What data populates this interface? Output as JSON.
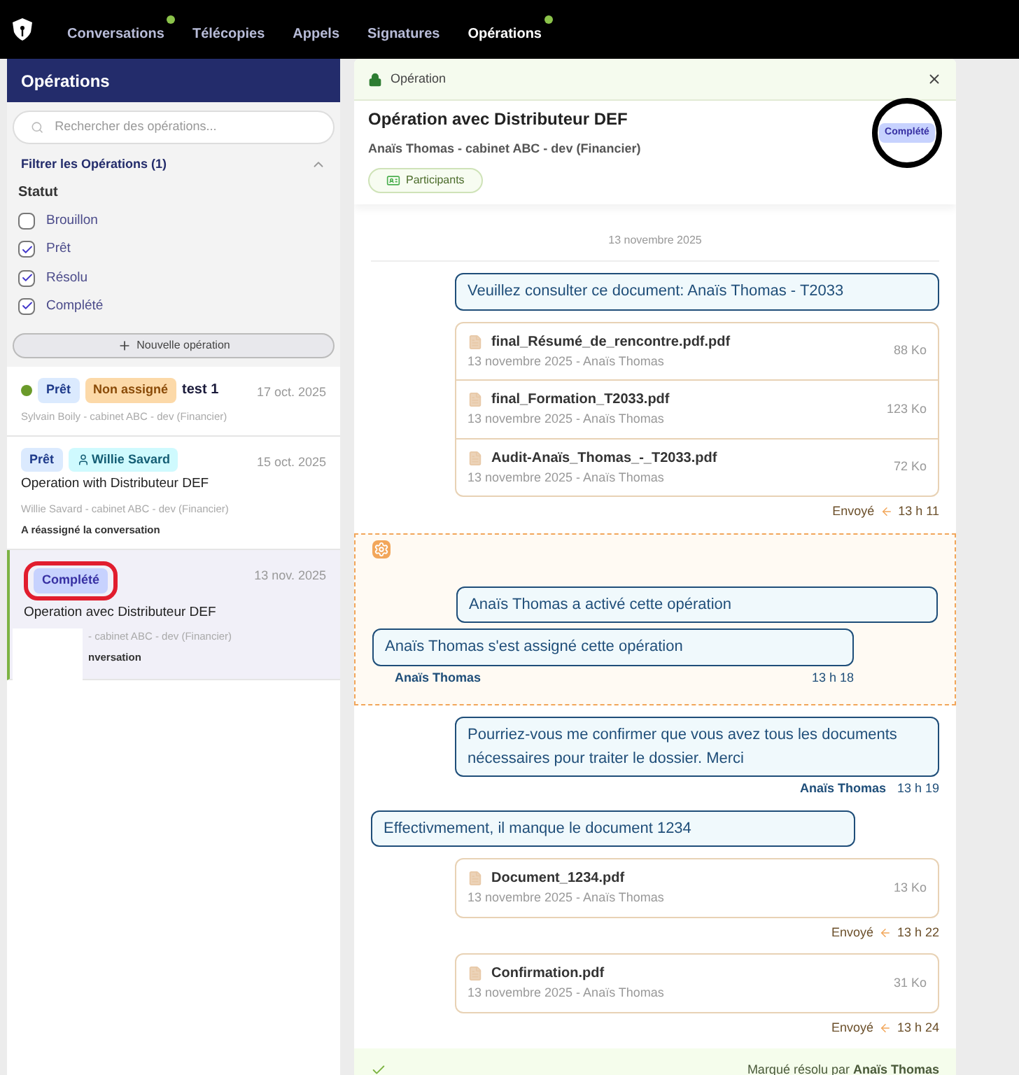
{
  "nav": [
    {
      "label": "Conversations",
      "selected": false,
      "dot": true
    },
    {
      "label": "Télécopies",
      "selected": false,
      "dot": false
    },
    {
      "label": "Appels",
      "selected": false,
      "dot": false
    },
    {
      "label": "Signatures",
      "selected": false,
      "dot": false
    },
    {
      "label": "Opérations",
      "selected": true,
      "dot": true
    }
  ],
  "sidebar": {
    "title": "Opérations",
    "search": {
      "placeholder": "Rechercher des opérations..."
    },
    "filter": {
      "title": "Filtrer les Opérations (1)",
      "expanded": true,
      "group": "Statut",
      "options": [
        {
          "label": "Brouillon",
          "checked": false
        },
        {
          "label": "Prêt",
          "checked": true
        },
        {
          "label": "Résolu",
          "checked": true
        },
        {
          "label": "Complété",
          "checked": true
        }
      ]
    },
    "new_button": "Nouvelle opération",
    "items": [
      {
        "selected": false,
        "color": "#6a9a2a",
        "tags": [
          {
            "label": "Prêt",
            "kind": "status",
            "annotated": false
          },
          {
            "label": "Non assigné",
            "kind": "unassigned",
            "annotated": false
          }
        ],
        "title": "test 1",
        "title_inline": true,
        "date": "17 oct. 2025",
        "subtitle": "Sylvain Boily - cabinet ABC - dev (Financier)"
      },
      {
        "selected": false,
        "tags": [
          {
            "label": "Prêt",
            "kind": "status",
            "annotated": false
          },
          {
            "label": "Willie Savard",
            "kind": "assignee",
            "annotated": false
          }
        ],
        "title": "Operation with Distributeur DEF",
        "title_inline": false,
        "date": "15 oct. 2025",
        "subtitle": "Willie Savard - cabinet ABC - dev (Financier)",
        "note": "A réassigné la conversation"
      },
      {
        "selected": true,
        "tags": [
          {
            "label": "Complété",
            "kind": "complete",
            "annotated": true
          }
        ],
        "title": "Operation avec Distributeur DEF",
        "title_inline": false,
        "date": "13 nov. 2025",
        "subtitle": "- cabinet ABC - dev (Financier)",
        "note": "nversation",
        "occluded": true
      }
    ]
  },
  "panel": {
    "header": "Opération",
    "title": "Opération avec Distributeur DEF",
    "subtitle": "Anaïs Thomas - cabinet ABC - dev (Financier)",
    "badge": "Complété",
    "participants": "Participants",
    "date_divider": "13 novembre 2025",
    "messages": [
      {
        "kind": "out",
        "text": "Veuillez consulter ce document: Anaïs Thomas - T2033"
      },
      {
        "kind": "files",
        "files": [
          {
            "name": "final_Résumé_de_rencontre.pdf.pdf",
            "meta": "13 novembre 2025 - Anaïs Thomas",
            "size": "88 Ko"
          },
          {
            "name": "final_Formation_T2033.pdf",
            "meta": "13 novembre 2025 - Anaïs Thomas",
            "size": "123 Ko"
          },
          {
            "name": "Audit-Anaïs_Thomas_-_T2033.pdf",
            "meta": "13 novembre 2025 - Anaïs Thomas",
            "size": "72 Ko"
          }
        ],
        "status": "Envoyé",
        "time": "13 h 11"
      },
      {
        "kind": "system",
        "items": [
          {
            "kind": "out",
            "text": "Anaïs Thomas a activé cette opération"
          },
          {
            "kind": "in",
            "text": "Anaïs Thomas s'est assigné cette opération",
            "author": "Anaïs Thomas",
            "time": "13 h 18"
          }
        ]
      },
      {
        "kind": "out",
        "text": "Pourriez-vous me confirmer que vous avez tous les documents nécessaires pour traiter le dossier. Merci",
        "author": "Anaïs Thomas",
        "time": "13 h 19"
      },
      {
        "kind": "in",
        "text": "Effectivmement, il manque le document 1234"
      },
      {
        "kind": "files",
        "files": [
          {
            "name": "Document_1234.pdf",
            "meta": "13 novembre 2025 - Anaïs Thomas",
            "size": "13 Ko"
          }
        ],
        "status": "Envoyé",
        "time": "13 h 22"
      },
      {
        "kind": "files",
        "files": [
          {
            "name": "Confirmation.pdf",
            "meta": "13 novembre 2025 - Anaïs Thomas",
            "size": "31 Ko"
          }
        ],
        "status": "Envoyé",
        "time": "13 h 24"
      }
    ],
    "resolved": "Marqué résolu par **Anaïs Thomas**"
  }
}
